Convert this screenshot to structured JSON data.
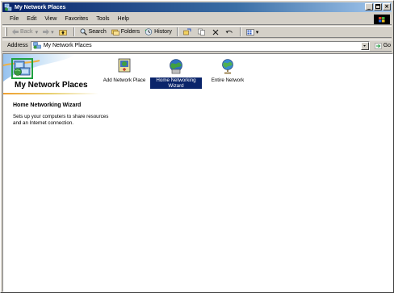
{
  "window": {
    "title": "My Network Places"
  },
  "titlebar_buttons": [
    "_",
    "Б",
    "×"
  ],
  "menu": [
    "File",
    "Edit",
    "View",
    "Favorites",
    "Tools",
    "Help"
  ],
  "toolbar": {
    "back": "Back",
    "search": "Search",
    "folders": "Folders",
    "history": "History"
  },
  "address": {
    "label": "Address",
    "value": "My Network Places",
    "go": "Go"
  },
  "left_panel": {
    "title": "My Network Places",
    "section_title": "Home Networking Wizard",
    "section_text": "Sets up your computers to share resources and an Internet connection."
  },
  "icons": [
    {
      "label": "Add Network Place",
      "icon": "add-network-place-icon",
      "selected": false
    },
    {
      "label": "Home Networking Wizard",
      "icon": "home-networking-wizard-icon",
      "selected": true
    },
    {
      "label": "Entire Network",
      "icon": "entire-network-icon",
      "selected": false
    }
  ],
  "colors": {
    "titlebar": "#0a246a",
    "selection": "#0a246a",
    "highlight_box": "#20a040"
  }
}
